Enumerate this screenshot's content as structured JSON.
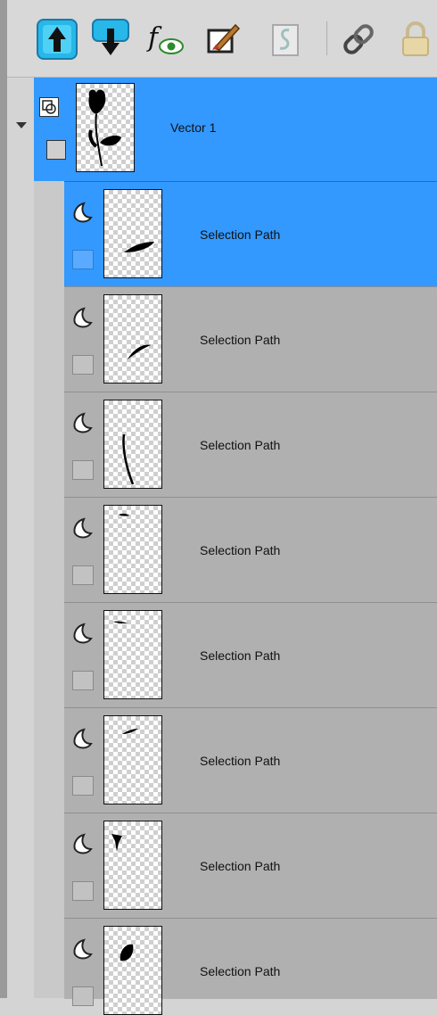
{
  "toolbar": {
    "buttons": [
      {
        "name": "move-up",
        "icon": "arrow-up-icon"
      },
      {
        "name": "move-down",
        "icon": "arrow-down-icon"
      },
      {
        "name": "layer-effects",
        "icon": "fx-eye-icon"
      },
      {
        "name": "edit-layer",
        "icon": "brush-edit-icon"
      },
      {
        "name": "script",
        "icon": "script-icon"
      },
      {
        "name": "link",
        "icon": "chain-link-icon"
      },
      {
        "name": "lock",
        "icon": "padlock-icon"
      }
    ]
  },
  "group_layer": {
    "name": "Vector 1",
    "expanded": true,
    "selected": true
  },
  "path_rows": [
    {
      "label": "Selection Path",
      "selected": true
    },
    {
      "label": "Selection Path",
      "selected": false
    },
    {
      "label": "Selection Path",
      "selected": false
    },
    {
      "label": "Selection Path",
      "selected": false
    },
    {
      "label": "Selection Path",
      "selected": false
    },
    {
      "label": "Selection Path",
      "selected": false
    },
    {
      "label": "Selection Path",
      "selected": false
    },
    {
      "label": "Selection Path",
      "selected": false
    }
  ],
  "colors": {
    "selection": "#3399ff",
    "row_bg": "#b0b0b0",
    "panel_bg": "#d4d4d4"
  }
}
